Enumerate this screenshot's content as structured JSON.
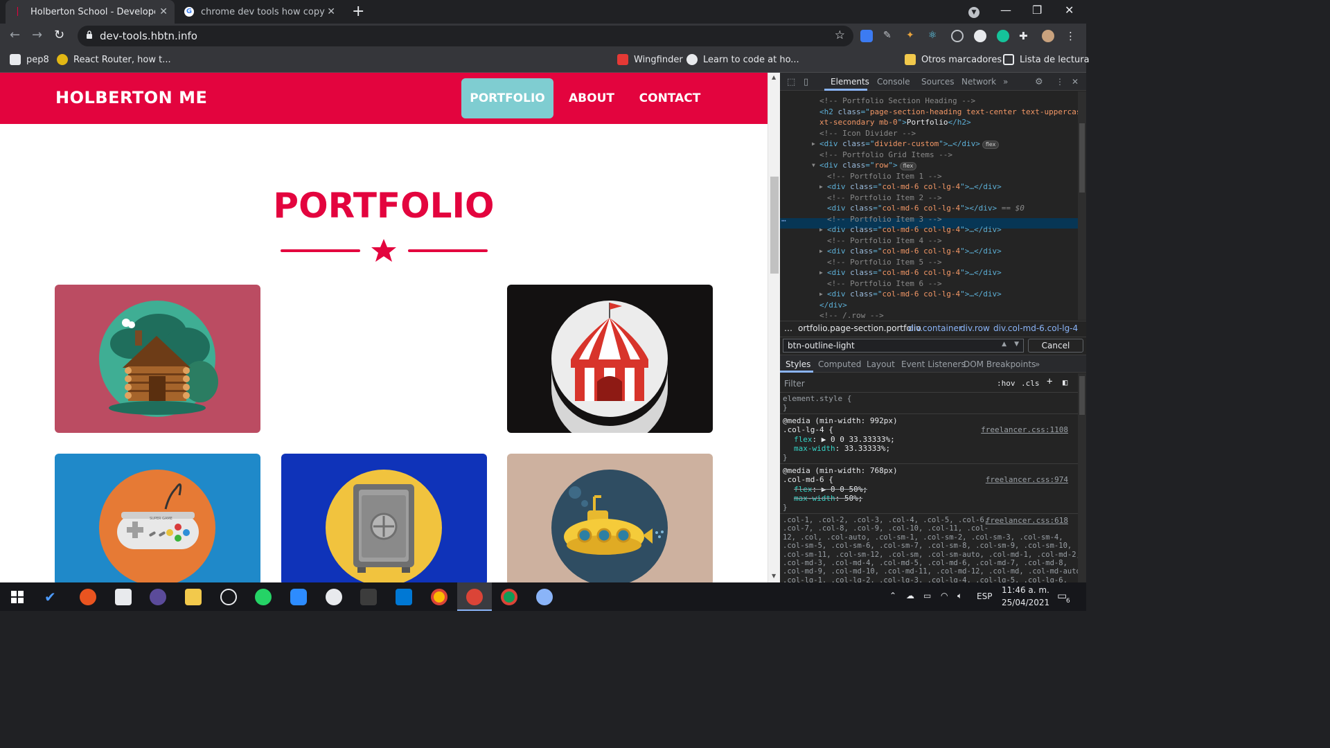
{
  "tabs": [
    {
      "title": "Holberton School - Developer to",
      "active": true
    },
    {
      "title": "chrome dev tools how copy style",
      "active": false
    }
  ],
  "toolbar": {
    "url": "dev-tools.hbtn.info"
  },
  "bookmarks": [
    {
      "label": "pep8"
    },
    {
      "label": "React Router, how t..."
    },
    {
      "label": "Wingfinder"
    },
    {
      "label": "Learn to code at ho..."
    },
    {
      "label": "Otros marcadores"
    },
    {
      "label": "Lista de lectura"
    }
  ],
  "site": {
    "brand": "HOLBERTON ME",
    "nav": [
      "PORTFOLIO",
      "ABOUT",
      "CONTACT"
    ],
    "heading": "PORTFOLIO",
    "cards": [
      {
        "name": "cabin",
        "bg": "#bb4c62"
      },
      {
        "name": "circus-tent",
        "bg": "#131111"
      },
      {
        "name": "game-controller",
        "bg": "#1f89c9"
      },
      {
        "name": "safe",
        "bg": "#0f33b9"
      },
      {
        "name": "submarine",
        "bg": "#cdb19f"
      }
    ],
    "controller_label": "SUPER GAME"
  },
  "colors": {
    "primary": "#e3043e",
    "accent": "#7fcdd1"
  },
  "devtools": {
    "tabs": [
      "Elements",
      "Console",
      "Sources",
      "Network"
    ],
    "dom": [
      {
        "indent": 5,
        "comment": "<!-- Portfolio Section Heading -->"
      },
      {
        "indent": 5,
        "h2a": "<h2 ",
        "h2b": "class",
        "h2c": "=\"",
        "h2d": "page-section-heading text-center text-uppercase te",
        "kind": "h2-1"
      },
      {
        "indent": 5,
        "kind": "h2-2",
        "p1": "xt-secondary mb-0",
        "p2": "\">",
        "p3": "Portfolio",
        "p4": "</h2>"
      },
      {
        "indent": 5,
        "comment": "<!-- Icon Divider -->"
      },
      {
        "indent": 5,
        "kind": "div",
        "arrow": "▶",
        "cls": "divider-custom",
        "tail": "…</div>",
        "badge": "flex"
      },
      {
        "indent": 5,
        "comment": "<!-- Portfolio Grid Items -->"
      },
      {
        "indent": 5,
        "kind": "div",
        "arrow": "▼",
        "cls": "row",
        "tail": "",
        "badge": "flex"
      },
      {
        "indent": 6,
        "comment": "<!-- Portfolio Item 1 -->"
      },
      {
        "indent": 6,
        "kind": "div",
        "arrow": "▶",
        "cls": "col-md-6 col-lg-4",
        "tail": "…</div>"
      },
      {
        "indent": 6,
        "comment": "<!-- Portfolio Item 2 -->"
      },
      {
        "indent": 6,
        "kind": "div",
        "arrow": "",
        "cls": "col-md-6 col-lg-4",
        "tail": "</div>",
        "sel": " == $0"
      },
      {
        "indent": 6,
        "comment": "<!-- Portfolio Item 3 -->"
      },
      {
        "indent": 6,
        "kind": "div",
        "arrow": "▶",
        "cls": "col-md-6 col-lg-4",
        "tail": "…</div>"
      },
      {
        "indent": 6,
        "comment": "<!-- Portfolio Item 4 -->"
      },
      {
        "indent": 6,
        "kind": "div",
        "arrow": "▶",
        "cls": "col-md-6 col-lg-4",
        "tail": "…</div>"
      },
      {
        "indent": 6,
        "comment": "<!-- Portfolio Item 5 -->"
      },
      {
        "indent": 6,
        "kind": "div",
        "arrow": "▶",
        "cls": "col-md-6 col-lg-4",
        "tail": "…</div>"
      },
      {
        "indent": 6,
        "comment": "<!-- Portfolio Item 6 -->"
      },
      {
        "indent": 6,
        "kind": "div",
        "arrow": "▶",
        "cls": "col-md-6 col-lg-4",
        "tail": "…</div>"
      },
      {
        "indent": 5,
        "close": "</div>"
      },
      {
        "indent": 5,
        "comment": "<!-- /.row -->"
      }
    ],
    "breadcrumbs": [
      "…",
      "ortfolio.page-section.portfolio",
      "div.container",
      "div.row",
      "div.col-md-6.col-lg-4"
    ],
    "search_value": "btn-outline-light",
    "cancel": "Cancel",
    "subtabs": [
      "Styles",
      "Computed",
      "Layout",
      "Event Listeners",
      "DOM Breakpoints"
    ],
    "filter_placeholder": "Filter",
    "hov": ":hov",
    "cls": ".cls",
    "styles": {
      "element_style": "element.style {",
      "close": "}",
      "m1": "@media (min-width: 992px)",
      "s1": ".col-lg-4 {",
      "src1": "freelancer.css:1108",
      "p1a": "flex",
      "v1a": "▶ 0 0 33.33333%;",
      "p1b": "max-width",
      "v1b": "33.33333%;",
      "m2": "@media (min-width: 768px)",
      "s2": ".col-md-6 {",
      "src2": "freelancer.css:974",
      "p2a": "flex",
      "v2a": "▶ 0 0 50%;",
      "p2b": "max-width",
      "v2b": "50%;",
      "src3": "freelancer.css:618",
      "grid": [
        ".col-1, .col-2, .col-3, .col-4, .col-5, .col-6,",
        ".col-7, .col-8, .col-9, .col-10, .col-11, .col-",
        "12, .col, .col-auto, .col-sm-1, .col-sm-2, .col-sm-3, .col-sm-4,",
        ".col-sm-5, .col-sm-6, .col-sm-7, .col-sm-8, .col-sm-9, .col-sm-10,",
        ".col-sm-11, .col-sm-12, .col-sm, .col-sm-auto, .col-md-1, .col-md-2,",
        ".col-md-3, .col-md-4, .col-md-5, .col-md-6, .col-md-7, .col-md-8,",
        ".col-md-9, .col-md-10, .col-md-11, .col-md-12, .col-md, .col-md-auto,",
        ".col-lg-1, .col-lg-2, .col-lg-3, .col-lg-4, .col-lg-5, .col-lg-6,"
      ]
    }
  },
  "taskbar": {
    "lang": "ESP",
    "time": "11:46 a. m.",
    "date": "25/04/2021",
    "notif": "6"
  }
}
